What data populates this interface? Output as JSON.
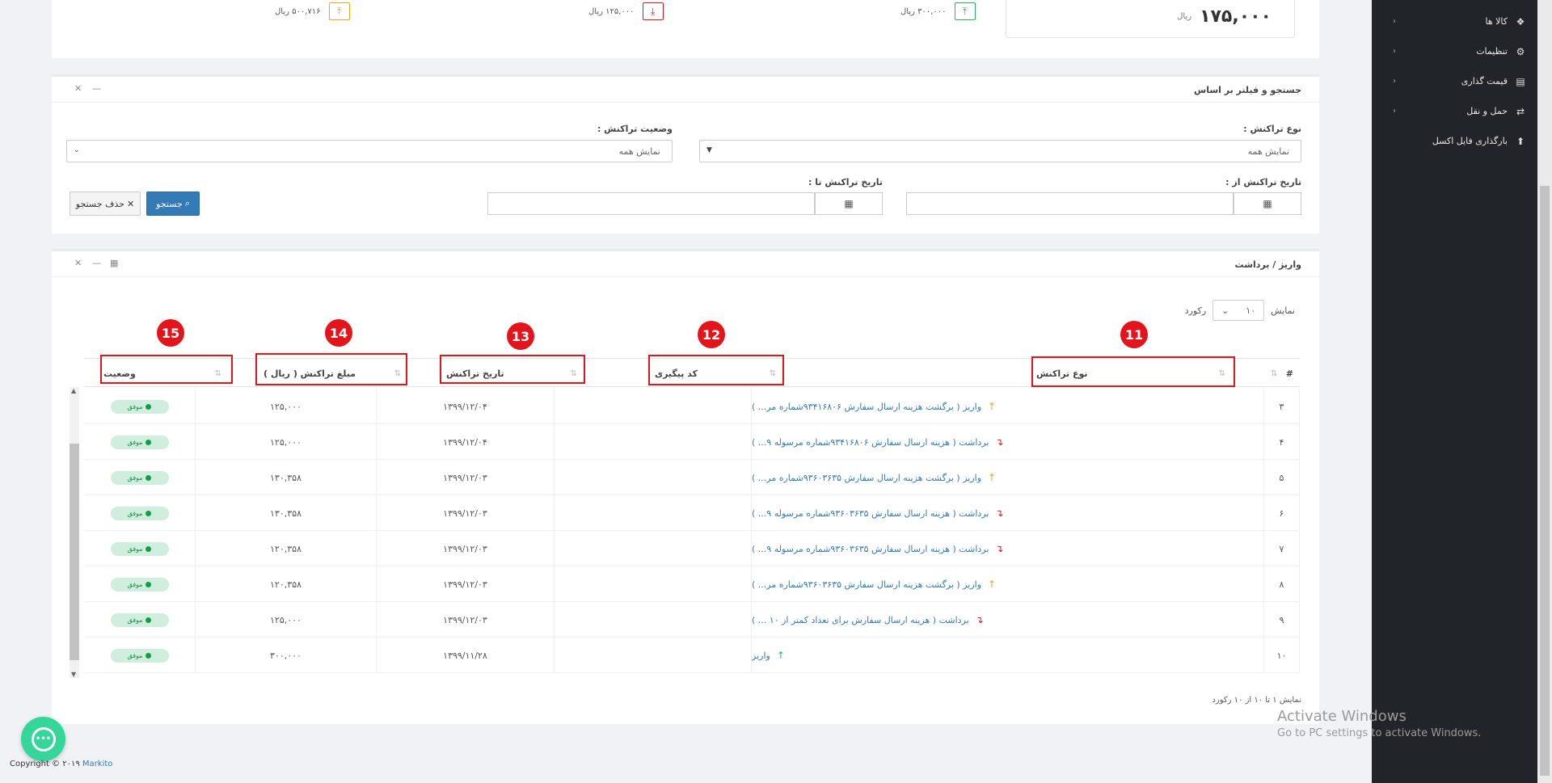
{
  "sidebar": {
    "items": [
      {
        "label": "کالا ها",
        "icon": "cubes-icon",
        "glyph": "❖"
      },
      {
        "label": "تنظیمات",
        "icon": "gear-icon",
        "glyph": "⚙"
      },
      {
        "label": "قیمت گذاری",
        "icon": "chart-icon",
        "glyph": "▤"
      },
      {
        "label": "حمل و نقل",
        "icon": "transfer-icon",
        "glyph": "⇄"
      },
      {
        "label": "بارگذاری فایل اکسل",
        "icon": "upload-icon",
        "glyph": "⬆"
      }
    ]
  },
  "summary": {
    "balance": "۱۷۵,۰۰۰",
    "balance_unit": "ریال",
    "deposit": "۳۰۰,۰۰۰ ریال",
    "withdraw": "۱۲۵,۰۰۰ ریال",
    "returned": "۵۰۰,۷۱۶ ریال"
  },
  "filter": {
    "title": "جستجو و فیلتر بر اساس",
    "type_label": "نوع تراکنش :",
    "type_value": "نمایش همه",
    "status_label": "وضعیت تراکنش :",
    "status_value": "نمایش همه",
    "date_from_label": "تاریخ تراکنش از :",
    "date_to_label": "تاریخ تراکنش تا :",
    "search_label": "جستجو",
    "clear_label": "حذف جستجو"
  },
  "table": {
    "title": "واریز / برداشت",
    "show_label": "نمایش",
    "page_size": "۱۰",
    "record_label": "رکورد",
    "columns": {
      "index": "#",
      "type": "نوع تراکنش",
      "tracking": "کد پیگیری",
      "date": "تاریخ تراکنش",
      "amount": "مبلغ تراکنش ( ریال )",
      "status": "وضعیت"
    },
    "annotations": [
      "11",
      "12",
      "13",
      "14",
      "15"
    ],
    "rows": [
      {
        "idx": "۳",
        "dir": "up",
        "type": "واریز ( برگشت هزینه ارسال سفارش ۹۳۴۱۶۸۰۶شماره مر... )",
        "tracking": "",
        "date": "۱۳۹۹/۱۲/۰۴",
        "amount": "۱۲۵,۰۰۰",
        "status": "موفق"
      },
      {
        "idx": "۴",
        "dir": "down",
        "type": "برداشت ( هزینه ارسال سفارش ۹۳۴۱۶۸۰۶شماره مرسوله ۹... )",
        "tracking": "",
        "date": "۱۳۹۹/۱۲/۰۴",
        "amount": "۱۲۵,۰۰۰",
        "status": "موفق"
      },
      {
        "idx": "۵",
        "dir": "up",
        "type": "واریز ( برگشت هزینه ارسال سفارش ۹۳۶۰۳۶۳۵شماره مر... )",
        "tracking": "",
        "date": "۱۳۹۹/۱۲/۰۳",
        "amount": "۱۳۰,۳۵۸",
        "status": "موفق"
      },
      {
        "idx": "۶",
        "dir": "down",
        "type": "برداشت ( هزینه ارسال سفارش ۹۳۶۰۳۶۳۵شماره مرسوله ۹... )",
        "tracking": "",
        "date": "۱۳۹۹/۱۲/۰۳",
        "amount": "۱۳۰,۳۵۸",
        "status": "موفق"
      },
      {
        "idx": "۷",
        "dir": "down",
        "type": "برداشت ( هزینه ارسال سفارش ۹۳۶۰۳۶۳۵شماره مرسوله ۹... )",
        "tracking": "",
        "date": "۱۳۹۹/۱۲/۰۳",
        "amount": "۱۲۰,۳۵۸",
        "status": "موفق"
      },
      {
        "idx": "۸",
        "dir": "up",
        "type": "واریز ( برگشت هزینه ارسال سفارش ۹۳۶۰۳۶۳۵شماره مر... )",
        "tracking": "",
        "date": "۱۳۹۹/۱۲/۰۳",
        "amount": "۱۲۰,۳۵۸",
        "status": "موفق"
      },
      {
        "idx": "۹",
        "dir": "down",
        "type": "برداشت ( هزینه ارسال سفارش برای تعداد کمتر از ۱۰ ... )",
        "tracking": "",
        "date": "۱۳۹۹/۱۲/۰۳",
        "amount": "۱۲۵,۰۰۰",
        "status": "موفق"
      },
      {
        "idx": "۱۰",
        "dir": "up-green",
        "type": "واریز",
        "tracking": "",
        "date": "۱۳۹۹/۱۱/۲۸",
        "amount": "۳۰۰,۰۰۰",
        "status": "موفق"
      }
    ],
    "info": "نمایش ۱ تا ۱۰ از ۱۰ رکورد"
  },
  "footer": {
    "copyright": "Copyright © ۲۰۱۹",
    "brand": "Markito"
  },
  "watermark": {
    "line1": "Activate Windows",
    "line2": "Go to PC settings to activate Windows."
  }
}
